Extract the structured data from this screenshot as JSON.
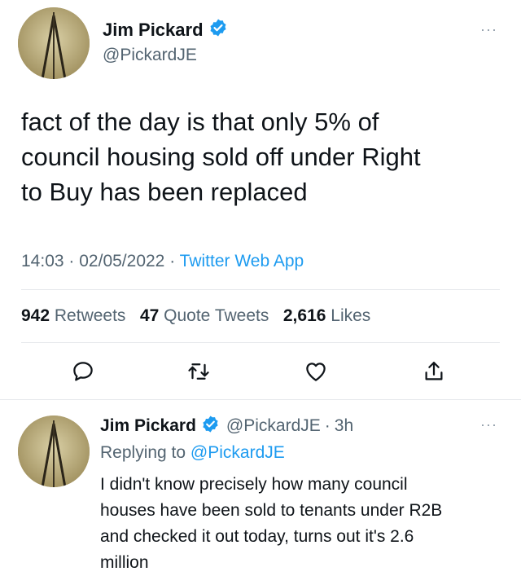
{
  "main_tweet": {
    "author_name": "Jim Pickard",
    "author_handle": "@PickardJE",
    "more": "···",
    "text_lines": [
      "fact of the day is that only 5% of",
      "council housing sold off under Right",
      "to Buy has been replaced"
    ],
    "time": "14:03",
    "date": "02/05/2022",
    "separator": "·",
    "source": "Twitter Web App",
    "retweets_count": "942",
    "retweets_label": "Retweets",
    "quote_count": "47",
    "quote_label": "Quote Tweets",
    "likes_count": "2,616",
    "likes_label": "Likes"
  },
  "reply_tweet": {
    "author_name": "Jim Pickard",
    "author_handle": "@PickardJE",
    "separator": "·",
    "time_ago": "3h",
    "more": "···",
    "replying_prefix": "Replying to",
    "replying_handle": "@PickardJE",
    "text_lines": [
      "I didn't know precisely how many council",
      "houses have been sold to tenants under R2B",
      "and checked it out today, turns out it's 2.6",
      "million"
    ]
  },
  "colors": {
    "accent": "#1d9bf0",
    "text": "#0f1419",
    "secondary": "#536471",
    "divider": "#e6e9ec"
  },
  "icons": [
    "verified-badge-icon",
    "reply-icon",
    "retweet-icon",
    "like-icon",
    "share-icon"
  ]
}
